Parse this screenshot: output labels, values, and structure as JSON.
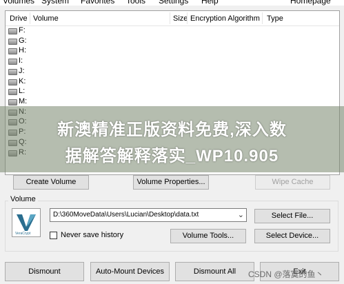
{
  "menu": {
    "items": [
      "Volumes",
      "System",
      "Favorites",
      "Tools",
      "Settings",
      "Help",
      "Homepage"
    ]
  },
  "drive_list": {
    "columns": [
      "Drive",
      "Volume",
      "Size",
      "Encryption Algorithm",
      "Type"
    ],
    "drives": [
      "F:",
      "G:",
      "H:",
      "I:",
      "J:",
      "K:",
      "L:",
      "M:",
      "N:",
      "O:",
      "P:",
      "Q:",
      "R:"
    ]
  },
  "watermark": {
    "line1": "新澳精准正版资料免费,深入数",
    "line2": "据解答解释落实_WP10.905"
  },
  "buttons": {
    "create_volume": "Create Volume",
    "volume_properties": "Volume Properties...",
    "wipe_cache": "Wipe Cache",
    "select_file": "Select File...",
    "volume_tools": "Volume Tools...",
    "select_device": "Select Device...",
    "dismount": "Dismount",
    "auto_mount": "Auto-Mount Devices",
    "dismount_all": "Dismount All",
    "exit": "Exit"
  },
  "volume_group": {
    "title": "Volume",
    "path_value": "D:\\360MoveData\\Users\\Lucian\\Desktop\\data.txt",
    "never_save_history": "Never save history",
    "logo_text": "VeraCrypt"
  },
  "overlay": {
    "csdn": "CSDN @落寞的鱼丶"
  },
  "colors": {
    "button_face": "#e1e1e1",
    "window_bg": "#f0f0f0",
    "logo_accent": "#2a6e8f"
  }
}
